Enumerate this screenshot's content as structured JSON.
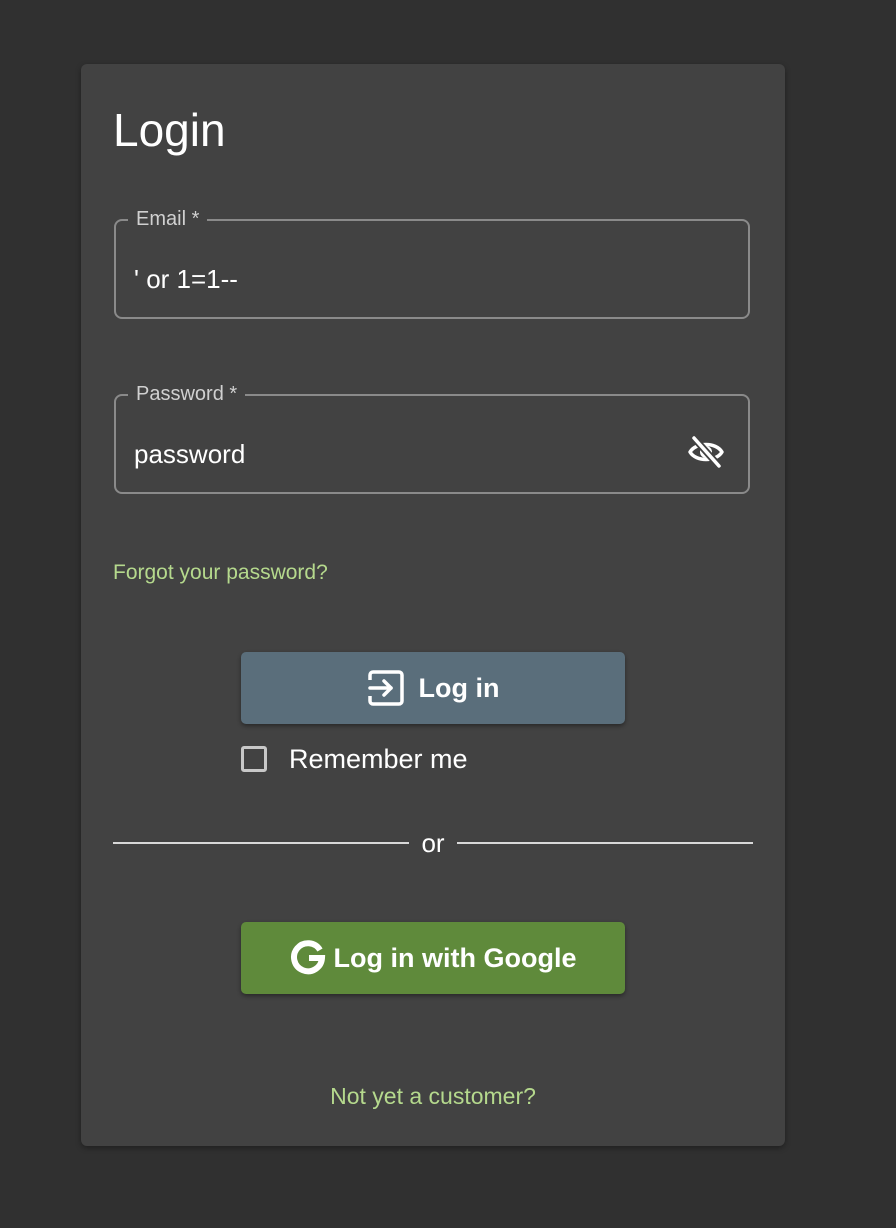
{
  "colors": {
    "page_background": "#303030",
    "card_background": "#424242",
    "accent_link": "#b5d98d",
    "login_button": "#5a6e7b",
    "google_button": "#5f8a3b"
  },
  "login": {
    "title": "Login",
    "email": {
      "label": "Email *",
      "value": "' or 1=1--"
    },
    "password": {
      "label": "Password *",
      "value": "password",
      "visibility_icon": "eye-off-icon"
    },
    "forgot_link": "Forgot your password?",
    "login_button": {
      "label": "Log in",
      "icon": "login-icon"
    },
    "remember_me": {
      "label": "Remember me",
      "checked": false
    },
    "divider_text": "or",
    "google_button": {
      "label": "Log in with Google",
      "icon": "google-icon"
    },
    "signup_link": "Not yet a customer?"
  }
}
